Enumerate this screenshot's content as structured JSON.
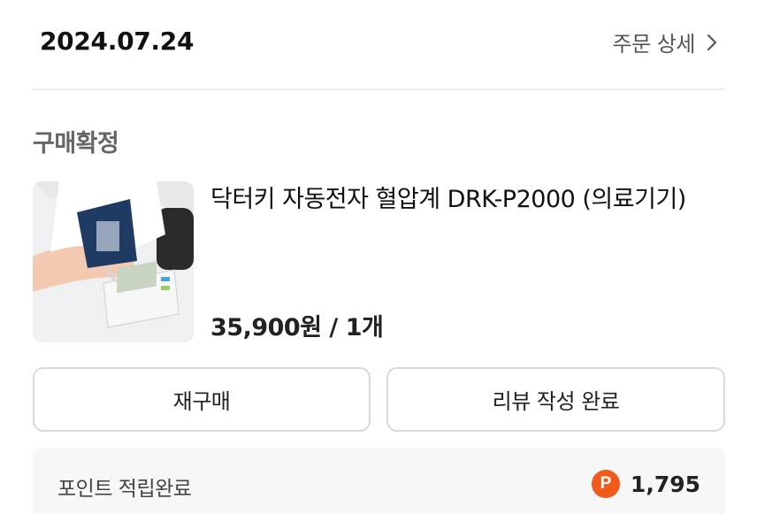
{
  "order": {
    "date": "2024.07.24",
    "detail_label": "주문 상세"
  },
  "status": "구매확정",
  "product": {
    "name": "닥터키 자동전자 혈압계 DRK-P2000 (의료기기)",
    "price": "35,900원 / 1개",
    "image_alt": "blood pressure monitor product photo"
  },
  "actions": {
    "reorder_label": "재구매",
    "review_label": "리뷰 작성 완료"
  },
  "points": {
    "label": "포인트 적립완료",
    "icon_text": "P",
    "value": "1,795",
    "icon_color": "#f05a1a"
  },
  "icons": {
    "detail_chevron": "chevron-right-icon",
    "points": "points-coin-icon"
  }
}
